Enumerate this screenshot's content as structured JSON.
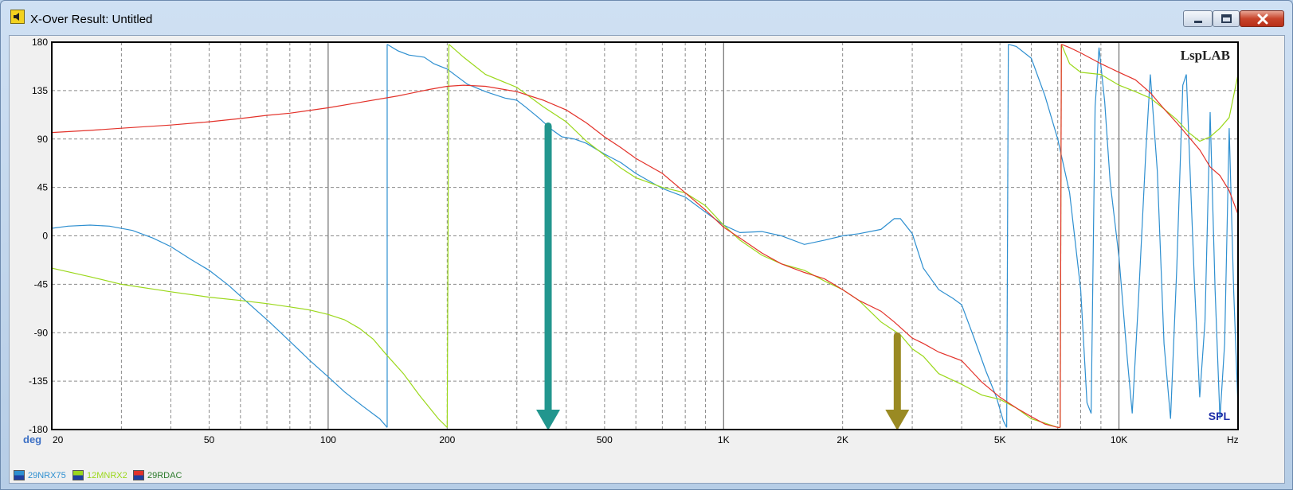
{
  "window": {
    "title": "X-Over Result: Untitled",
    "icon": "speaker-icon",
    "buttons": [
      "minimize",
      "maximize",
      "close"
    ]
  },
  "chart_data": {
    "type": "line",
    "watermark": "LspLAB",
    "mode_label": "SPL",
    "ylabel": "deg",
    "xlabel": "Hz",
    "x_scale": "log",
    "xlim": [
      20,
      20000
    ],
    "ylim": [
      -180,
      180
    ],
    "grid": true,
    "yticks": [
      180,
      135,
      90,
      45,
      0,
      -45,
      -90,
      -135,
      -180
    ],
    "xticks_major": [
      {
        "v": 20,
        "label": "20"
      },
      {
        "v": 50,
        "label": "50"
      },
      {
        "v": 100,
        "label": "100"
      },
      {
        "v": 200,
        "label": "200"
      },
      {
        "v": 500,
        "label": "500"
      },
      {
        "v": 1000,
        "label": "1K"
      },
      {
        "v": 2000,
        "label": "2K"
      },
      {
        "v": 5000,
        "label": "5K"
      },
      {
        "v": 10000,
        "label": "10K"
      }
    ],
    "series": [
      {
        "name": "29NRX75",
        "color": "#2e8fd0",
        "points": [
          [
            20,
            7
          ],
          [
            22,
            9
          ],
          [
            25,
            10
          ],
          [
            28,
            9
          ],
          [
            32,
            5
          ],
          [
            36,
            -2
          ],
          [
            40,
            -10
          ],
          [
            45,
            -22
          ],
          [
            50,
            -32
          ],
          [
            56,
            -46
          ],
          [
            63,
            -63
          ],
          [
            71,
            -80
          ],
          [
            80,
            -98
          ],
          [
            90,
            -116
          ],
          [
            100,
            -131
          ],
          [
            110,
            -145
          ],
          [
            122,
            -158
          ],
          [
            135,
            -170
          ],
          [
            141,
            -178
          ],
          [
            141,
            178
          ],
          [
            150,
            172
          ],
          [
            160,
            168
          ],
          [
            175,
            166
          ],
          [
            185,
            160
          ],
          [
            200,
            155
          ],
          [
            212,
            148
          ],
          [
            225,
            141
          ],
          [
            250,
            134
          ],
          [
            280,
            128
          ],
          [
            300,
            126
          ],
          [
            315,
            120
          ],
          [
            340,
            110
          ],
          [
            370,
            98
          ],
          [
            390,
            92
          ],
          [
            420,
            90
          ],
          [
            450,
            86
          ],
          [
            500,
            76
          ],
          [
            550,
            68
          ],
          [
            600,
            58
          ],
          [
            700,
            44
          ],
          [
            800,
            36
          ],
          [
            900,
            22
          ],
          [
            1000,
            10
          ],
          [
            1100,
            3
          ],
          [
            1250,
            4
          ],
          [
            1400,
            0
          ],
          [
            1600,
            -8
          ],
          [
            1800,
            -4
          ],
          [
            2000,
            0
          ],
          [
            2200,
            2
          ],
          [
            2500,
            6
          ],
          [
            2700,
            16
          ],
          [
            2800,
            16
          ],
          [
            3000,
            2
          ],
          [
            3200,
            -30
          ],
          [
            3500,
            -50
          ],
          [
            3800,
            -58
          ],
          [
            4000,
            -64
          ],
          [
            4300,
            -95
          ],
          [
            4600,
            -125
          ],
          [
            4900,
            -150
          ],
          [
            5100,
            -172
          ],
          [
            5200,
            -178
          ],
          [
            5250,
            178
          ],
          [
            5500,
            176
          ],
          [
            6000,
            165
          ],
          [
            6500,
            130
          ],
          [
            7000,
            90
          ],
          [
            7500,
            40
          ],
          [
            8000,
            -50
          ],
          [
            8300,
            -155
          ],
          [
            8500,
            -165
          ],
          [
            8700,
            120
          ],
          [
            8900,
            175
          ],
          [
            9200,
            125
          ],
          [
            9500,
            50
          ],
          [
            10000,
            -20
          ],
          [
            10500,
            -115
          ],
          [
            10800,
            -165
          ],
          [
            11200,
            -60
          ],
          [
            11700,
            80
          ],
          [
            12000,
            150
          ],
          [
            12500,
            60
          ],
          [
            13000,
            -100
          ],
          [
            13500,
            -170
          ],
          [
            14000,
            -30
          ],
          [
            14500,
            140
          ],
          [
            14800,
            150
          ],
          [
            15500,
            -40
          ],
          [
            16000,
            -150
          ],
          [
            16500,
            -80
          ],
          [
            17000,
            115
          ],
          [
            17500,
            -50
          ],
          [
            18000,
            -170
          ],
          [
            18500,
            -100
          ],
          [
            19000,
            100
          ],
          [
            19500,
            -50
          ],
          [
            20000,
            -160
          ]
        ]
      },
      {
        "name": "12MNRX2",
        "color": "#9bd81b",
        "points": [
          [
            20,
            -30
          ],
          [
            25,
            -38
          ],
          [
            30,
            -45
          ],
          [
            40,
            -52
          ],
          [
            50,
            -57
          ],
          [
            60,
            -60
          ],
          [
            70,
            -63
          ],
          [
            80,
            -66
          ],
          [
            90,
            -69
          ],
          [
            100,
            -73
          ],
          [
            110,
            -78
          ],
          [
            120,
            -86
          ],
          [
            130,
            -96
          ],
          [
            140,
            -110
          ],
          [
            155,
            -128
          ],
          [
            170,
            -148
          ],
          [
            190,
            -170
          ],
          [
            200,
            -178
          ],
          [
            202,
            178
          ],
          [
            220,
            166
          ],
          [
            250,
            150
          ],
          [
            300,
            138
          ],
          [
            350,
            120
          ],
          [
            400,
            106
          ],
          [
            450,
            88
          ],
          [
            500,
            75
          ],
          [
            550,
            63
          ],
          [
            600,
            54
          ],
          [
            700,
            45
          ],
          [
            800,
            40
          ],
          [
            900,
            28
          ],
          [
            1000,
            10
          ],
          [
            1100,
            -4
          ],
          [
            1250,
            -18
          ],
          [
            1400,
            -26
          ],
          [
            1600,
            -32
          ],
          [
            1800,
            -42
          ],
          [
            2000,
            -50
          ],
          [
            2200,
            -60
          ],
          [
            2500,
            -80
          ],
          [
            2800,
            -92
          ],
          [
            3000,
            -105
          ],
          [
            3200,
            -112
          ],
          [
            3500,
            -128
          ],
          [
            4000,
            -138
          ],
          [
            4500,
            -148
          ],
          [
            5000,
            -152
          ],
          [
            5500,
            -160
          ],
          [
            6000,
            -170
          ],
          [
            6500,
            -174
          ],
          [
            7000,
            -178
          ],
          [
            7100,
            -178
          ],
          [
            7150,
            178
          ],
          [
            7500,
            160
          ],
          [
            8000,
            152
          ],
          [
            9000,
            150
          ],
          [
            10000,
            140
          ],
          [
            11000,
            134
          ],
          [
            12000,
            128
          ],
          [
            13000,
            118
          ],
          [
            14000,
            108
          ],
          [
            15000,
            96
          ],
          [
            16000,
            88
          ],
          [
            17000,
            92
          ],
          [
            18000,
            100
          ],
          [
            19000,
            110
          ],
          [
            20000,
            150
          ]
        ]
      },
      {
        "name": "29RDAC",
        "color": "#e3322a",
        "points": [
          [
            20,
            96
          ],
          [
            25,
            98
          ],
          [
            30,
            100
          ],
          [
            40,
            103
          ],
          [
            50,
            106
          ],
          [
            60,
            109
          ],
          [
            70,
            112
          ],
          [
            80,
            114
          ],
          [
            100,
            119
          ],
          [
            120,
            124
          ],
          [
            150,
            130
          ],
          [
            180,
            136
          ],
          [
            200,
            139
          ],
          [
            220,
            140
          ],
          [
            250,
            139
          ],
          [
            300,
            134
          ],
          [
            350,
            126
          ],
          [
            400,
            117
          ],
          [
            450,
            105
          ],
          [
            500,
            92
          ],
          [
            550,
            82
          ],
          [
            600,
            72
          ],
          [
            700,
            58
          ],
          [
            800,
            40
          ],
          [
            900,
            24
          ],
          [
            1000,
            8
          ],
          [
            1100,
            -2
          ],
          [
            1250,
            -16
          ],
          [
            1400,
            -26
          ],
          [
            1600,
            -34
          ],
          [
            1800,
            -40
          ],
          [
            2000,
            -50
          ],
          [
            2200,
            -60
          ],
          [
            2500,
            -70
          ],
          [
            2700,
            -80
          ],
          [
            3000,
            -95
          ],
          [
            3200,
            -100
          ],
          [
            3500,
            -108
          ],
          [
            4000,
            -116
          ],
          [
            4500,
            -136
          ],
          [
            5000,
            -150
          ],
          [
            5500,
            -160
          ],
          [
            6000,
            -168
          ],
          [
            6500,
            -175
          ],
          [
            7000,
            -178
          ],
          [
            7100,
            -178
          ],
          [
            7150,
            178
          ],
          [
            7500,
            175
          ],
          [
            8000,
            170
          ],
          [
            9000,
            160
          ],
          [
            10000,
            152
          ],
          [
            11000,
            145
          ],
          [
            12000,
            133
          ],
          [
            13000,
            118
          ],
          [
            14000,
            105
          ],
          [
            15000,
            92
          ],
          [
            16000,
            80
          ],
          [
            17000,
            64
          ],
          [
            18000,
            56
          ],
          [
            19000,
            42
          ],
          [
            20000,
            20
          ]
        ]
      }
    ],
    "arrows": [
      {
        "color": "#22968e",
        "x": 360,
        "y_from": 105,
        "y_to": -180
      },
      {
        "color": "#9a8a23",
        "x": 2750,
        "y_from": -90,
        "y_to": -180
      }
    ]
  },
  "legend": [
    {
      "label": "29NRX75",
      "color": "#2e8fd0"
    },
    {
      "label": "12MNRX2",
      "color": "#9bd81b"
    },
    {
      "label": "29RDAC",
      "color": "#e3322a"
    }
  ]
}
